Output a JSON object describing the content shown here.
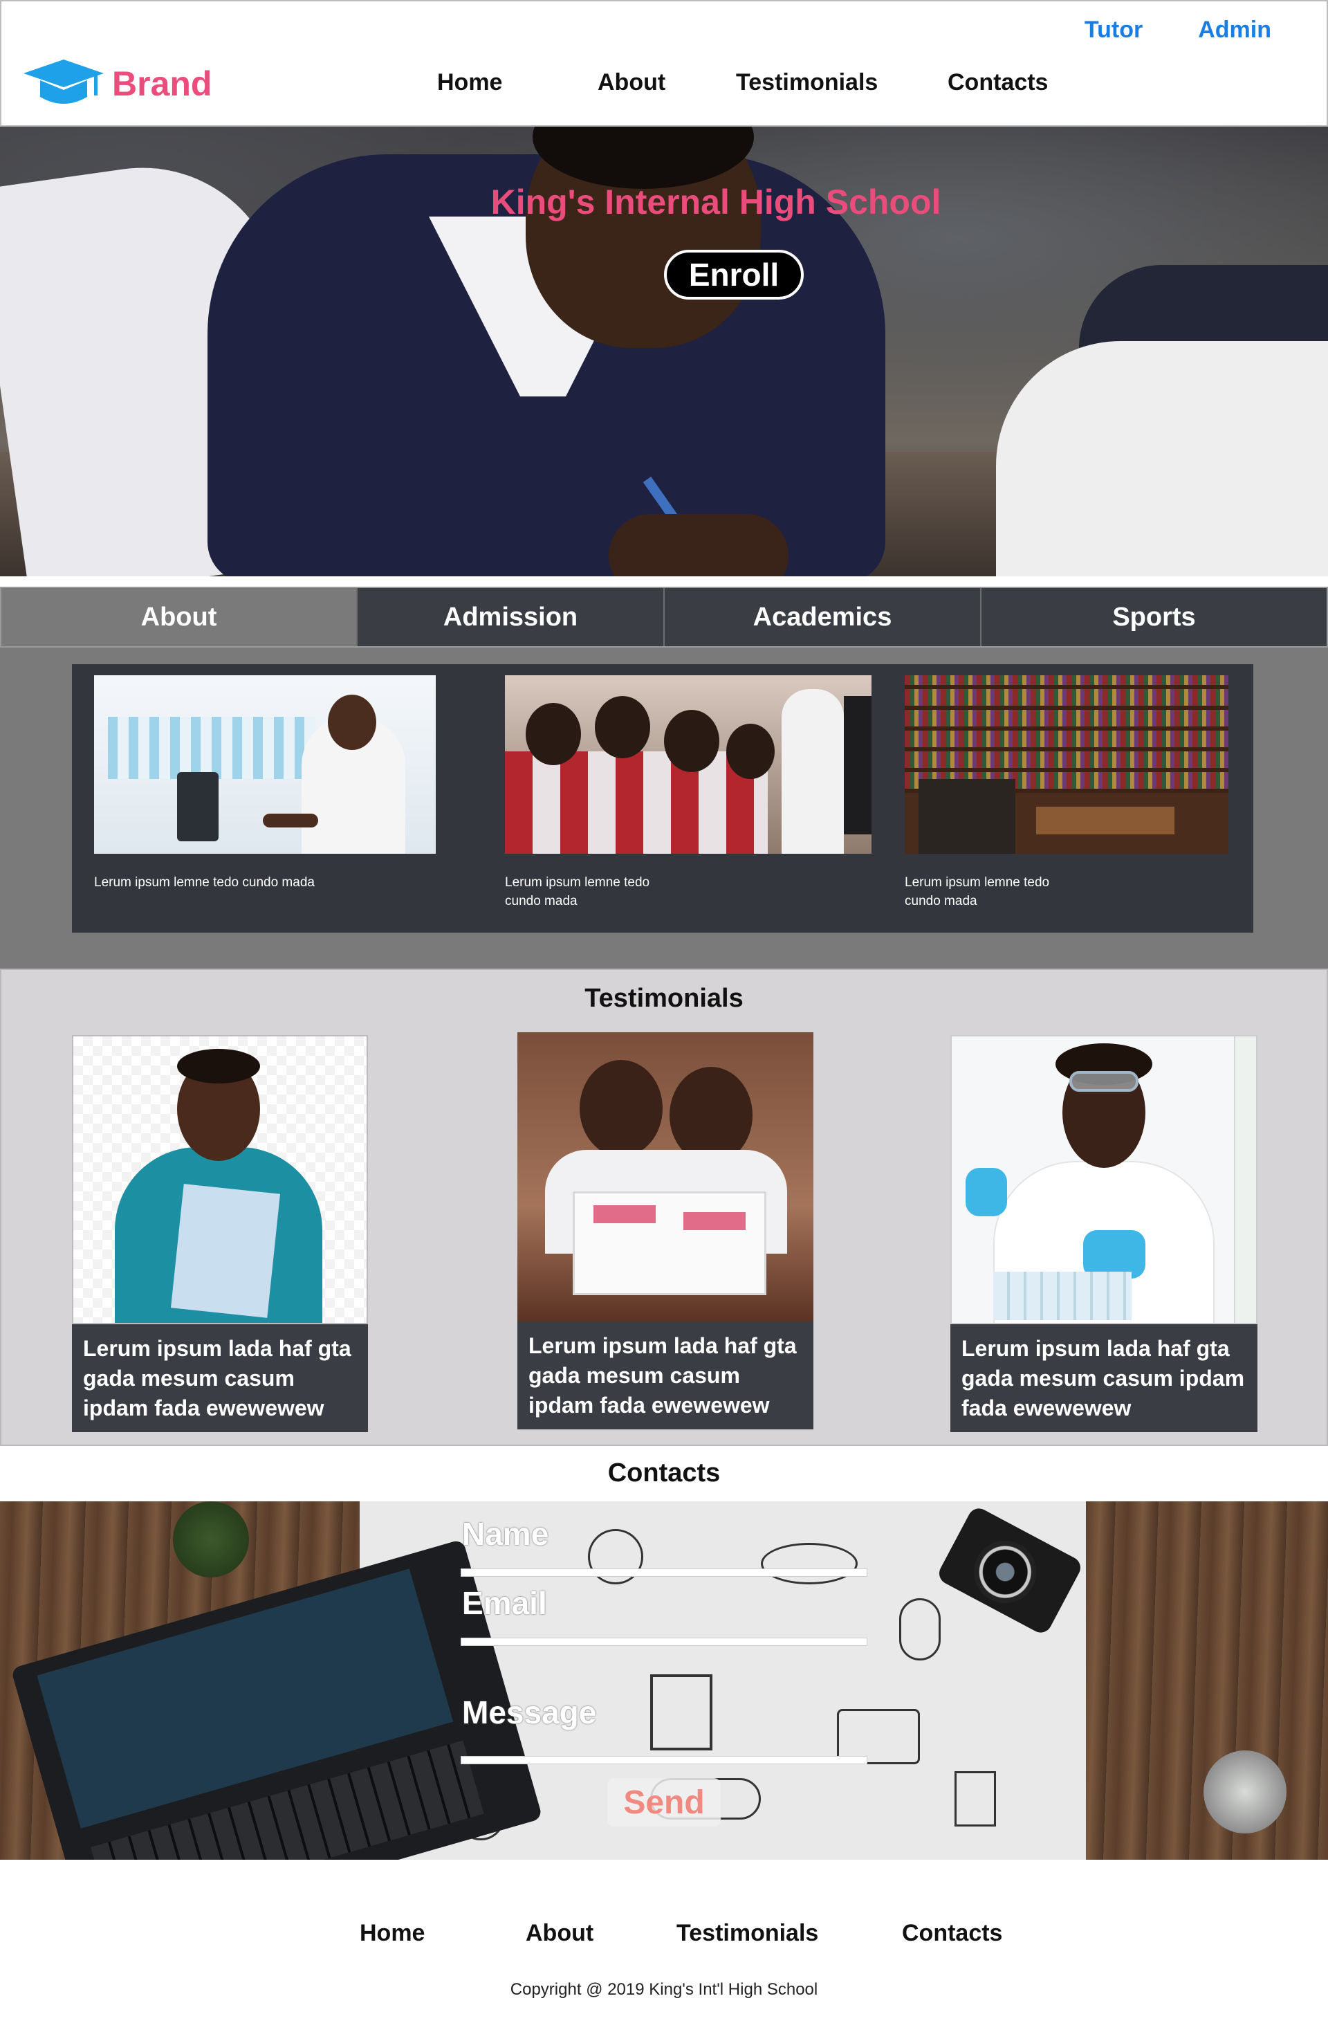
{
  "header": {
    "brand": "Brand",
    "top_links": [
      "Tutor",
      "Admin"
    ],
    "nav": [
      "Home",
      "About",
      "Testimonials",
      "Contacts"
    ]
  },
  "hero": {
    "title": "King's Internal High School",
    "button": "Enroll"
  },
  "tabs": [
    {
      "label": "About",
      "active": true
    },
    {
      "label": "Admission",
      "active": false
    },
    {
      "label": "Academics",
      "active": false
    },
    {
      "label": "Sports",
      "active": false
    }
  ],
  "about_cards": [
    {
      "image": "lab-student-image",
      "caption": "Lerum ipsum lemne tedo cundo mada"
    },
    {
      "image": "classroom-students-image",
      "caption": "Lerum ipsum lemne tedo cundo mada"
    },
    {
      "image": "library-image",
      "caption": "Lerum ipsum lemne tedo cundo mada"
    }
  ],
  "testimonials": {
    "title": "Testimonials",
    "items": [
      {
        "image": "student-with-book-image",
        "quote": "Lerum ipsum lada haf gta gada mesum casum ipdam fada ewewewew"
      },
      {
        "image": "girls-reading-image",
        "quote": "Lerum ipsum lada haf gta gada mesum casum ipdam fada ewewewew"
      },
      {
        "image": "scientist-student-image",
        "quote": "Lerum ipsum lada haf gta gada mesum casum ipdam fada ewewewew"
      }
    ]
  },
  "contacts": {
    "title": "Contacts",
    "name_label": "Name",
    "email_label": "Email",
    "message_label": "Message",
    "send_button": "Send"
  },
  "footer": {
    "nav": [
      "Home",
      "About",
      "Testimonials",
      "Contacts"
    ],
    "copyright": "Copyright @ 2019 King's Int'l High School"
  },
  "colors": {
    "brand_pink": "#ea4d7c",
    "link_blue": "#1a7ee0",
    "dark_panel": "#3a3d44",
    "grey_panel": "#7a7a7a",
    "testimonial_bg": "#d6d4d6",
    "send_text": "#f08a80"
  }
}
